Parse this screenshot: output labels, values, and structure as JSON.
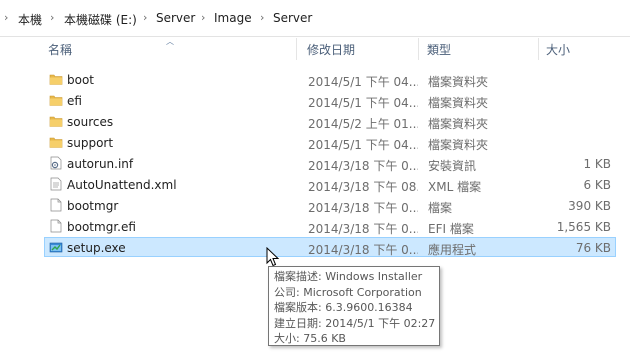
{
  "breadcrumb": [
    "本機",
    "本機磁碟 (E:)",
    "Server",
    "Image",
    "Server"
  ],
  "columns": {
    "name": "名稱",
    "date": "修改日期",
    "type": "類型",
    "size": "大小"
  },
  "files": [
    {
      "name": "boot",
      "date": "2014/5/1 下午 04...",
      "type": "檔案資料夾",
      "size": "",
      "icon": "folder-icon"
    },
    {
      "name": "efi",
      "date": "2014/5/1 下午 04...",
      "type": "檔案資料夾",
      "size": "",
      "icon": "folder-icon"
    },
    {
      "name": "sources",
      "date": "2014/5/2 上午 01...",
      "type": "檔案資料夾",
      "size": "",
      "icon": "folder-icon"
    },
    {
      "name": "support",
      "date": "2014/5/1 下午 04...",
      "type": "檔案資料夾",
      "size": "",
      "icon": "folder-icon"
    },
    {
      "name": "autorun.inf",
      "date": "2014/3/18 下午 0...",
      "type": "安裝資訊",
      "size": "1 KB",
      "icon": "settings-file-icon"
    },
    {
      "name": "AutoUnattend.xml",
      "date": "2014/3/18 下午 08...",
      "type": "XML 檔案",
      "size": "6 KB",
      "icon": "xml-file-icon"
    },
    {
      "name": "bootmgr",
      "date": "2014/3/18 下午 0...",
      "type": "檔案",
      "size": "390 KB",
      "icon": "file-icon"
    },
    {
      "name": "bootmgr.efi",
      "date": "2014/3/18 下午 0...",
      "type": "EFI 檔案",
      "size": "1,565 KB",
      "icon": "file-icon"
    },
    {
      "name": "setup.exe",
      "date": "2014/3/18 下午 0...",
      "type": "應用程式",
      "size": "76 KB",
      "icon": "setup-exe-icon",
      "selected": true
    }
  ],
  "tooltip": {
    "lines": [
      "檔案描述: Windows Installer",
      "公司: Microsoft Corporation",
      "檔案版本: 6.3.9600.16384",
      "建立日期: 2014/5/1 下午 02:27",
      "大小: 75.6 KB"
    ]
  },
  "colors": {
    "selection_bg": "#cce8ff",
    "selection_border": "#99d1ff",
    "header_text": "#4c607a",
    "folder": "#e8b84a"
  }
}
